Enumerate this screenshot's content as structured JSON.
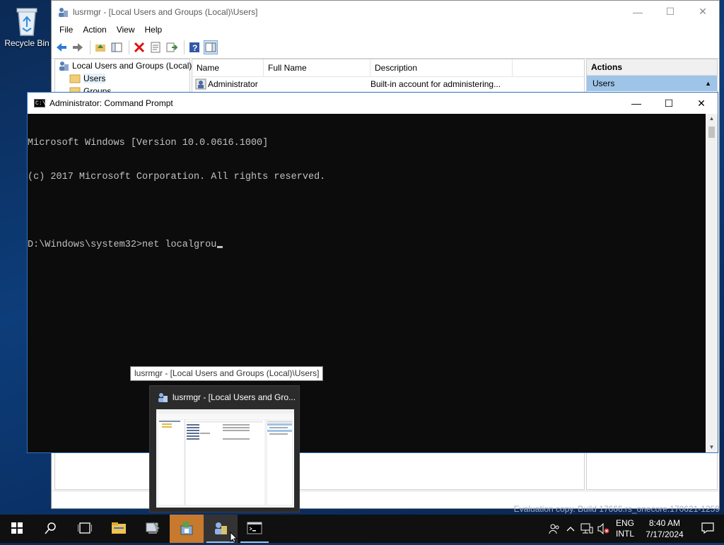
{
  "desktop": {
    "recycle_bin_label": "Recycle Bin"
  },
  "lusrmgr": {
    "title": "lusrmgr - [Local Users and Groups (Local)\\Users]",
    "menu": [
      "File",
      "Action",
      "View",
      "Help"
    ],
    "tree": {
      "root": "Local Users and Groups (Local)",
      "items": [
        "Users",
        "Groups"
      ]
    },
    "columns": [
      "Name",
      "Full Name",
      "Description"
    ],
    "rows": [
      {
        "name": "Administrator",
        "full_name": "",
        "description": "Built-in account for administering..."
      }
    ],
    "actions": {
      "header": "Actions",
      "section": "Users"
    }
  },
  "cmd": {
    "title": "Administrator: Command Prompt",
    "lines": [
      "Microsoft Windows [Version 10.0.0616.1000]",
      "(c) 2017 Microsoft Corporation. All rights reserved.",
      "",
      "D:\\Windows\\system32>net localgrou"
    ]
  },
  "tooltip": "lusrmgr - [Local Users and Groups (Local)\\Users]",
  "thumbnail_title": "lusrmgr - [Local Users and Gro...",
  "watermark": "Evaluation copy. Build 17666.rs_onecore.170621-1259",
  "taskbar": {
    "lang_top": "ENG",
    "lang_bottom": "INTL",
    "time": "8:40 AM",
    "date": "7/17/2024"
  },
  "colors": {
    "accent": "#2f73c0",
    "taskbar": "#101010",
    "console_bg": "#0c0c0c",
    "console_fg": "#c0c0c0",
    "highlight_app": "#c7792d"
  }
}
